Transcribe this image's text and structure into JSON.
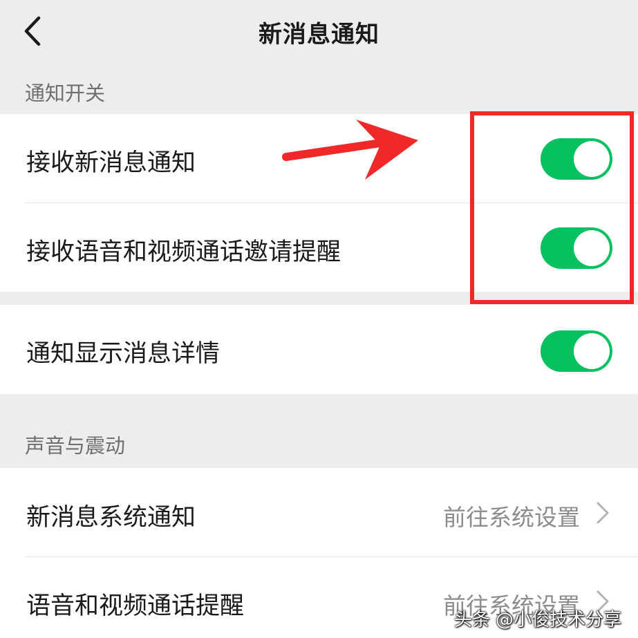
{
  "header": {
    "title": "新消息通知"
  },
  "sections": {
    "notification_switch": {
      "label": "通知开关"
    },
    "sound_vibration": {
      "label": "声音与震动"
    }
  },
  "rows": {
    "receive_new_message": {
      "label": "接收新消息通知",
      "enabled": true
    },
    "receive_call_invite": {
      "label": "接收语音和视频通话邀请提醒",
      "enabled": true
    },
    "show_message_detail": {
      "label": "通知显示消息详情",
      "enabled": true
    },
    "system_notification": {
      "label": "新消息系统通知",
      "value": "前往系统设置"
    },
    "call_reminder": {
      "label": "语音和视频通话提醒",
      "value": "前往系统设置"
    }
  },
  "colors": {
    "toggle_on": "#07c160",
    "annotation": "#f0282a",
    "background": "#ededed"
  },
  "icons": {
    "back": "back-icon",
    "chevron": "chevron-right-icon"
  },
  "watermark": "头条 @小俊技术分享"
}
